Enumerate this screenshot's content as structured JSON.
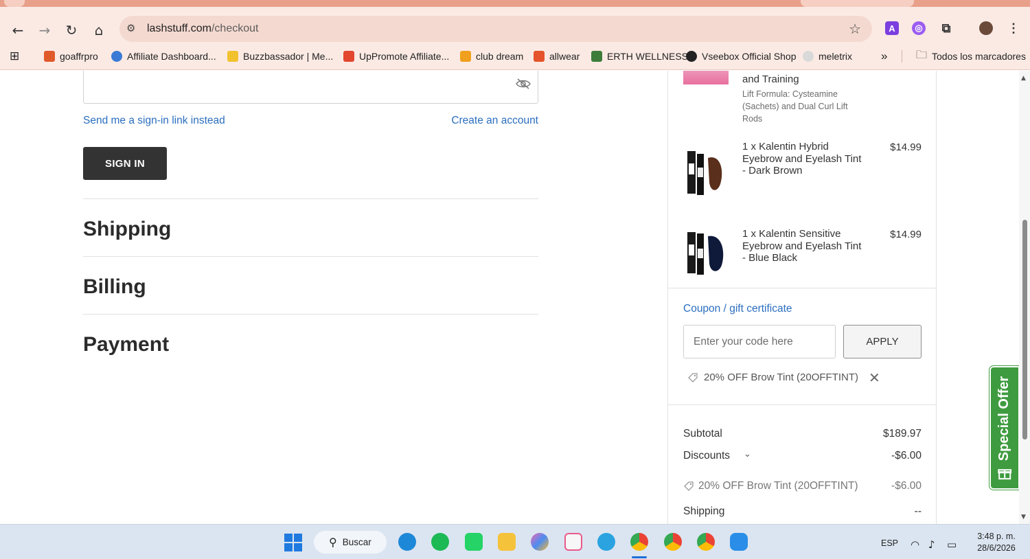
{
  "browser": {
    "url_host": "lashstuff.com",
    "url_path": "/checkout",
    "bookmarks": [
      {
        "label": "goaffrpro",
        "color": "#e05a2b"
      },
      {
        "label": "Affiliate Dashboard...",
        "color": "#3b7bd6"
      },
      {
        "label": "Buzzbassador | Me...",
        "color": "#f2c12e"
      },
      {
        "label": "UpPromote Affiliate...",
        "color": "#e2462f"
      },
      {
        "label": "club dream",
        "color": "#f0a01e"
      },
      {
        "label": "allwear",
        "color": "#e4532b"
      },
      {
        "label": "ERTH WELLNESS",
        "color": "#3d7d3a"
      },
      {
        "label": "Vseebox Official Shop",
        "color": "#222222"
      },
      {
        "label": "meletrix",
        "color": "#cccccc"
      }
    ],
    "more_bookmarks": "»",
    "all_bookmarks": "Todos los marcadores"
  },
  "signin": {
    "magic_link": "Send me a sign-in link instead",
    "create_account": "Create an account",
    "button": "SIGN IN"
  },
  "sections": {
    "shipping": "Shipping",
    "billing": "Billing",
    "payment": "Payment"
  },
  "summary": {
    "items": [
      {
        "name_tail": "and Training",
        "desc": "Lift Formula: Cysteamine (Sachets) and Dual Curl Lift Rods",
        "price": ""
      },
      {
        "name": "1 x Kalentin Hybrid Eyebrow and Eyelash Tint - Dark Brown",
        "price": "$14.99"
      },
      {
        "name": "1 x Kalentin Sensitive Eyebrow and Eyelash Tint - Blue Black",
        "price": "$14.99"
      }
    ],
    "coupon": {
      "link": "Coupon / gift certificate",
      "placeholder": "Enter your code here",
      "apply": "APPLY",
      "applied": "20% OFF Brow Tint (20OFFTINT)"
    },
    "totals": {
      "subtotal_label": "Subtotal",
      "subtotal": "$189.97",
      "discounts_label": "Discounts",
      "discounts": "-$6.00",
      "discount_line_label": "20% OFF Brow Tint (20OFFTINT)",
      "discount_line": "-$6.00",
      "shipping_label": "Shipping",
      "shipping": "--"
    }
  },
  "special_offer": "Special Offer",
  "taskbar": {
    "search": "Buscar",
    "lang": "ESP",
    "time": "3:48 p. m.",
    "date": "28/6/2026"
  }
}
